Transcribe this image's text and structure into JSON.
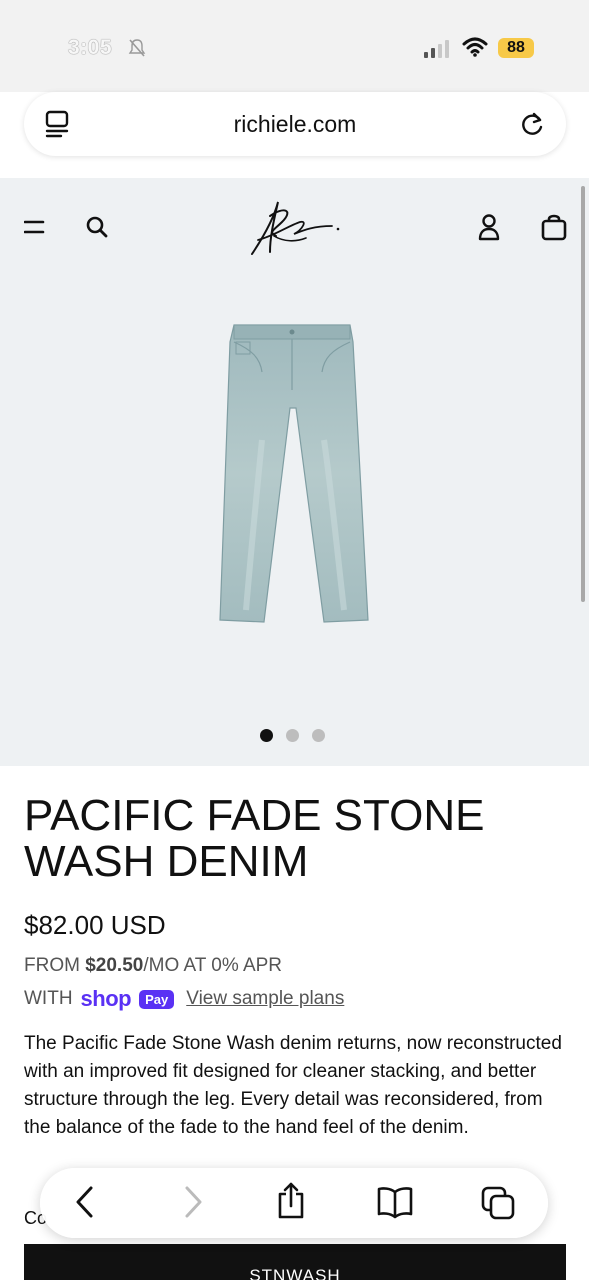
{
  "status_bar": {
    "time": "3:05",
    "battery": "88"
  },
  "browser": {
    "url": "richiele.com"
  },
  "product": {
    "title": "PACIFIC FADE STONE WASH DENIM",
    "price": "$82.00 USD",
    "installment_prefix": "FROM ",
    "installment_amount": "$20.50",
    "installment_suffix": "/MO AT 0% APR",
    "with_label": "WITH",
    "shop_word": "shop",
    "pay_badge": "Pay",
    "sample_plans_link": "View sample plans",
    "description": "The Pacific Fade Stone Wash denim returns, now reconstructed with an improved fit designed for cleaner stacking, and better structure through the leg. Every detail was reconsidered, from the balance of the fade to the hand feel of the denim.",
    "color_label": "Co",
    "variant_button": "STNWASH"
  },
  "gallery": {
    "slide_count": 3,
    "active_slide": 1
  },
  "icons": {
    "menu": "menu-icon",
    "search": "search-icon",
    "account": "account-icon",
    "bag": "bag-icon",
    "back": "back-icon",
    "forward": "forward-icon",
    "share": "share-icon",
    "bookmarks": "bookmarks-icon",
    "tabs": "tabs-icon"
  },
  "colors": {
    "hero_background": "#eef1f3",
    "shop_pay_purple": "#5a31f4",
    "battery_yellow": "#f7c948",
    "button_black": "#111111"
  }
}
